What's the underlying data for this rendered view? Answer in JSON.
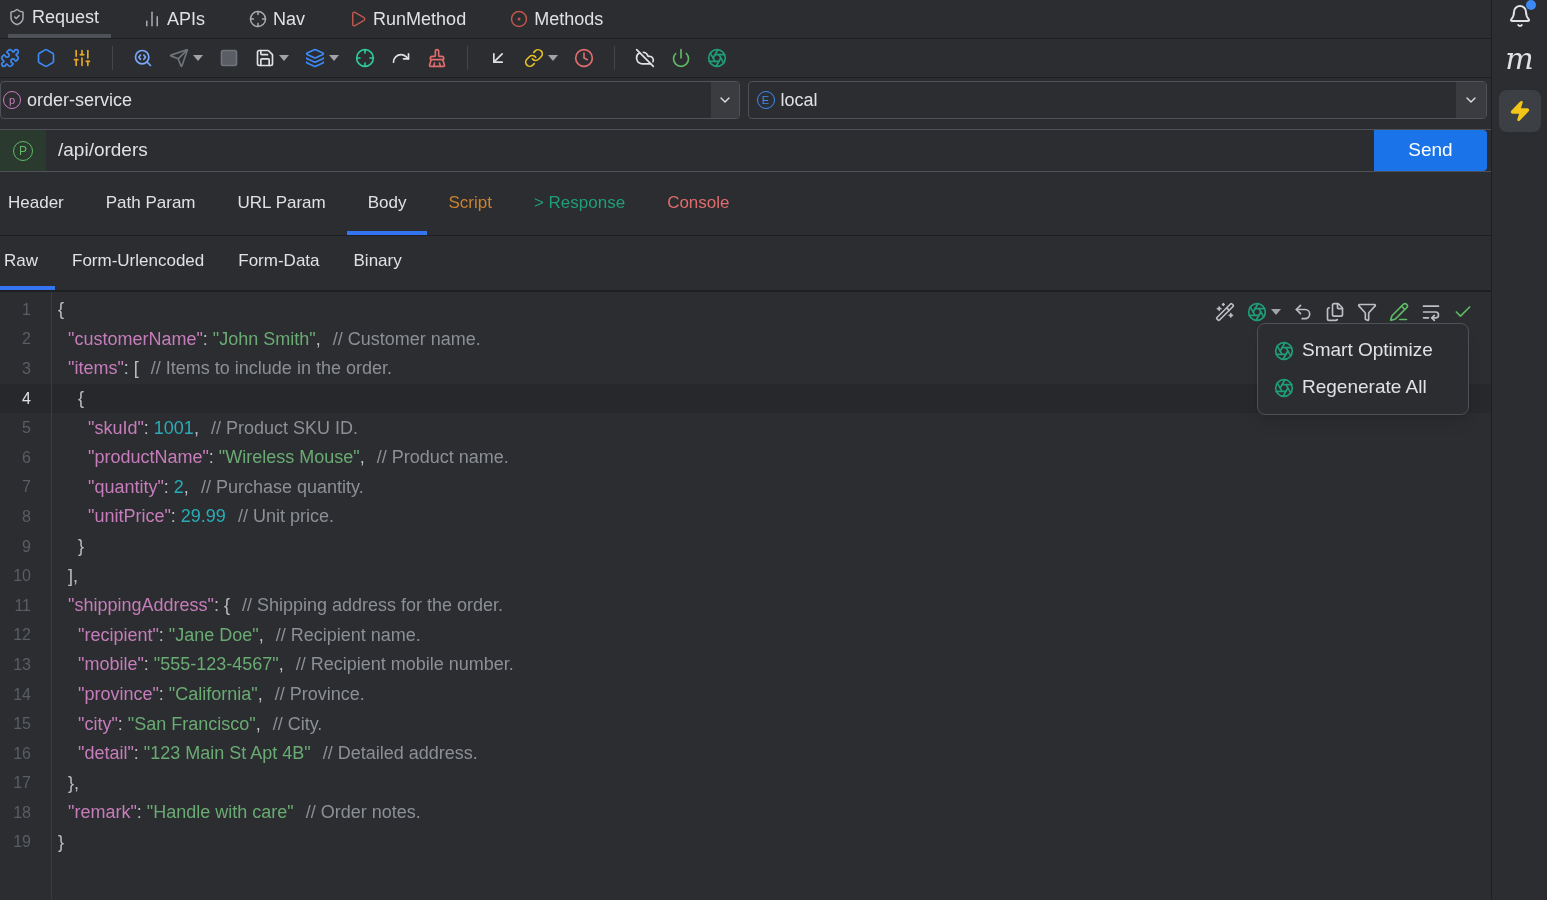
{
  "top_tabs": [
    {
      "label": "Request",
      "kind": "request",
      "selected": true
    },
    {
      "label": "APIs",
      "kind": "apis",
      "selected": false
    },
    {
      "label": "Nav",
      "kind": "nav",
      "selected": false
    },
    {
      "label": "RunMethod",
      "kind": "run",
      "selected": false
    },
    {
      "label": "Methods",
      "kind": "methods",
      "selected": false
    }
  ],
  "project": {
    "badge": "p",
    "value": "order-service"
  },
  "environment": {
    "badge": "E",
    "value": "local"
  },
  "url": {
    "badge": "P",
    "value": "/api/orders",
    "button": "Send"
  },
  "request_tabs": [
    {
      "label": "Header",
      "color": "#dfe1e5",
      "selected": false
    },
    {
      "label": "Path Param",
      "color": "#dfe1e5",
      "selected": false
    },
    {
      "label": "URL Param",
      "color": "#dfe1e5",
      "selected": false
    },
    {
      "label": "Body",
      "color": "#dfe1e5",
      "selected": true
    },
    {
      "label": "Script",
      "color": "#c9822f",
      "selected": false
    },
    {
      "label": "> Response",
      "color": "#1f9e78",
      "selected": false
    },
    {
      "label": "Console",
      "color": "#e06c6c",
      "selected": false
    }
  ],
  "body_tabs": [
    {
      "label": "Raw",
      "selected": true
    },
    {
      "label": "Form-Urlencoded",
      "selected": false
    },
    {
      "label": "Form-Data",
      "selected": false
    },
    {
      "label": "Binary",
      "selected": false
    }
  ],
  "editor": {
    "lines": [
      {
        "number": "1",
        "current": false,
        "tokens": [
          {
            "kind": "punct",
            "text": "{"
          }
        ]
      },
      {
        "number": "2",
        "current": false,
        "tokens": [
          {
            "kind": "key",
            "text": "\"customerName\""
          },
          {
            "kind": "punct",
            "text": ": "
          },
          {
            "kind": "string",
            "text": "\"John Smith\""
          },
          {
            "kind": "punct",
            "text": ","
          },
          {
            "kind": "comment",
            "text": "// Customer name."
          }
        ]
      },
      {
        "number": "3",
        "current": false,
        "tokens": [
          {
            "kind": "key",
            "text": "\"items\""
          },
          {
            "kind": "punct",
            "text": ": ["
          },
          {
            "kind": "comment",
            "text": "// Items to include in the order."
          }
        ]
      },
      {
        "number": "4",
        "current": true,
        "tokens": [
          {
            "kind": "punct",
            "text": "{"
          }
        ]
      },
      {
        "number": "5",
        "current": false,
        "tokens": [
          {
            "kind": "key",
            "text": "\"skuId\""
          },
          {
            "kind": "punct",
            "text": ": "
          },
          {
            "kind": "number",
            "text": "1001"
          },
          {
            "kind": "punct",
            "text": ","
          },
          {
            "kind": "comment",
            "text": "// Product SKU ID."
          }
        ]
      },
      {
        "number": "6",
        "current": false,
        "tokens": [
          {
            "kind": "key",
            "text": "\"productName\""
          },
          {
            "kind": "punct",
            "text": ": "
          },
          {
            "kind": "string",
            "text": "\"Wireless Mouse\""
          },
          {
            "kind": "punct",
            "text": ","
          },
          {
            "kind": "comment",
            "text": "// Product name."
          }
        ]
      },
      {
        "number": "7",
        "current": false,
        "tokens": [
          {
            "kind": "key",
            "text": "\"quantity\""
          },
          {
            "kind": "punct",
            "text": ": "
          },
          {
            "kind": "number",
            "text": "2"
          },
          {
            "kind": "punct",
            "text": ","
          },
          {
            "kind": "comment",
            "text": "// Purchase quantity."
          }
        ]
      },
      {
        "number": "8",
        "current": false,
        "tokens": [
          {
            "kind": "key",
            "text": "\"unitPrice\""
          },
          {
            "kind": "punct",
            "text": ": "
          },
          {
            "kind": "number",
            "text": "29.99"
          },
          {
            "kind": "comment",
            "text": "// Unit price."
          }
        ]
      },
      {
        "number": "9",
        "current": false,
        "tokens": [
          {
            "kind": "punct",
            "text": "}"
          }
        ]
      },
      {
        "number": "10",
        "current": false,
        "tokens": [
          {
            "kind": "punct",
            "text": "],"
          }
        ]
      },
      {
        "number": "11",
        "current": false,
        "tokens": [
          {
            "kind": "key",
            "text": "\"shippingAddress\""
          },
          {
            "kind": "punct",
            "text": ": {"
          },
          {
            "kind": "comment",
            "text": "// Shipping address for the order."
          }
        ]
      },
      {
        "number": "12",
        "current": false,
        "tokens": [
          {
            "kind": "key",
            "text": "\"recipient\""
          },
          {
            "kind": "punct",
            "text": ": "
          },
          {
            "kind": "string",
            "text": "\"Jane Doe\""
          },
          {
            "kind": "punct",
            "text": ","
          },
          {
            "kind": "comment",
            "text": "// Recipient name."
          }
        ]
      },
      {
        "number": "13",
        "current": false,
        "tokens": [
          {
            "kind": "key",
            "text": "\"mobile\""
          },
          {
            "kind": "punct",
            "text": ": "
          },
          {
            "kind": "string",
            "text": "\"555-123-4567\""
          },
          {
            "kind": "punct",
            "text": ","
          },
          {
            "kind": "comment",
            "text": "// Recipient mobile number."
          }
        ]
      },
      {
        "number": "14",
        "current": false,
        "tokens": [
          {
            "kind": "key",
            "text": "\"province\""
          },
          {
            "kind": "punct",
            "text": ": "
          },
          {
            "kind": "string",
            "text": "\"California\""
          },
          {
            "kind": "punct",
            "text": ","
          },
          {
            "kind": "comment",
            "text": "// Province."
          }
        ]
      },
      {
        "number": "15",
        "current": false,
        "tokens": [
          {
            "kind": "key",
            "text": "\"city\""
          },
          {
            "kind": "punct",
            "text": ": "
          },
          {
            "kind": "string",
            "text": "\"San Francisco\""
          },
          {
            "kind": "punct",
            "text": ","
          },
          {
            "kind": "comment",
            "text": "// City."
          }
        ]
      },
      {
        "number": "16",
        "current": false,
        "tokens": [
          {
            "kind": "key",
            "text": "\"detail\""
          },
          {
            "kind": "punct",
            "text": ": "
          },
          {
            "kind": "string",
            "text": "\"123 Main St Apt 4B\""
          },
          {
            "kind": "comment",
            "text": "// Detailed address."
          }
        ]
      },
      {
        "number": "17",
        "current": false,
        "tokens": [
          {
            "kind": "punct",
            "text": "},"
          }
        ]
      },
      {
        "number": "18",
        "current": false,
        "tokens": [
          {
            "kind": "key",
            "text": "\"remark\""
          },
          {
            "kind": "punct",
            "text": ": "
          },
          {
            "kind": "string",
            "text": "\"Handle with care\""
          },
          {
            "kind": "comment",
            "text": "// Order notes."
          }
        ]
      },
      {
        "number": "19",
        "current": false,
        "tokens": [
          {
            "kind": "punct",
            "text": "}"
          }
        ]
      }
    ],
    "ai_menu": [
      "Smart Optimize",
      "Regenerate All"
    ]
  },
  "side_bar": {
    "notification": true,
    "logo_letter": "m"
  }
}
